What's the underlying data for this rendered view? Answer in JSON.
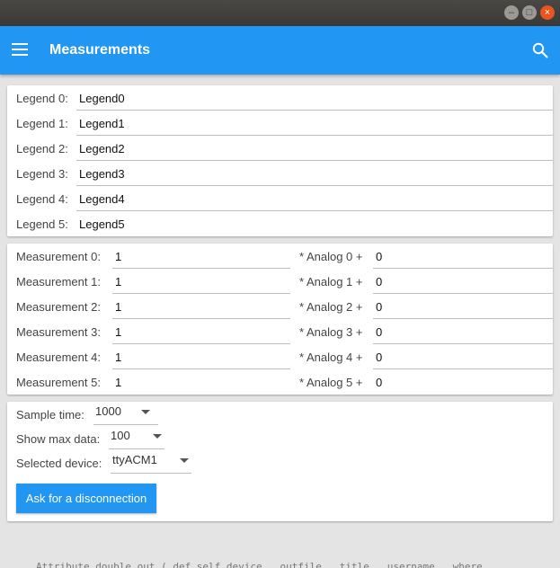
{
  "window": {
    "min_glyph": "–",
    "max_glyph": "□",
    "close_glyph": "×"
  },
  "appbar": {
    "title": "Measurements",
    "menu_icon": "hamburger-icon",
    "search_icon": "search-icon",
    "color": "#2196f3"
  },
  "legends": [
    {
      "label": "Legend 0:",
      "value": "Legend0"
    },
    {
      "label": "Legend 1:",
      "value": "Legend1"
    },
    {
      "label": "Legend 2:",
      "value": "Legend2"
    },
    {
      "label": "Legend 3:",
      "value": "Legend3"
    },
    {
      "label": "Legend 4:",
      "value": "Legend4"
    },
    {
      "label": "Legend 5:",
      "value": "Legend5"
    }
  ],
  "measurements": [
    {
      "label": "Measurement 0:",
      "value": "1",
      "analog_label": "* Analog 0 +",
      "analog_value": "0"
    },
    {
      "label": "Measurement 1:",
      "value": "1",
      "analog_label": "* Analog 1 +",
      "analog_value": "0"
    },
    {
      "label": "Measurement 2:",
      "value": "1",
      "analog_label": "* Analog 2 +",
      "analog_value": "0"
    },
    {
      "label": "Measurement 3:",
      "value": "1",
      "analog_label": "* Analog 3 +",
      "analog_value": "0"
    },
    {
      "label": "Measurement 4:",
      "value": "1",
      "analog_label": "* Analog 4 +",
      "analog_value": "0"
    },
    {
      "label": "Measurement 5:",
      "value": "1",
      "analog_label": "* Analog 5 +",
      "analog_value": "0"
    }
  ],
  "settings": {
    "sample_time": {
      "label": "Sample time:",
      "value": "1000"
    },
    "max_data": {
      "label": "Show max data:",
      "value": "100"
    },
    "device": {
      "label": "Selected device:",
      "value": "ttyACM1"
    },
    "button_label": "Ask for a disconnection"
  },
  "background_text": "Attribute  double  out  (  def  self  device  ,  outfile  ,  title  ,  username  ,  where"
}
